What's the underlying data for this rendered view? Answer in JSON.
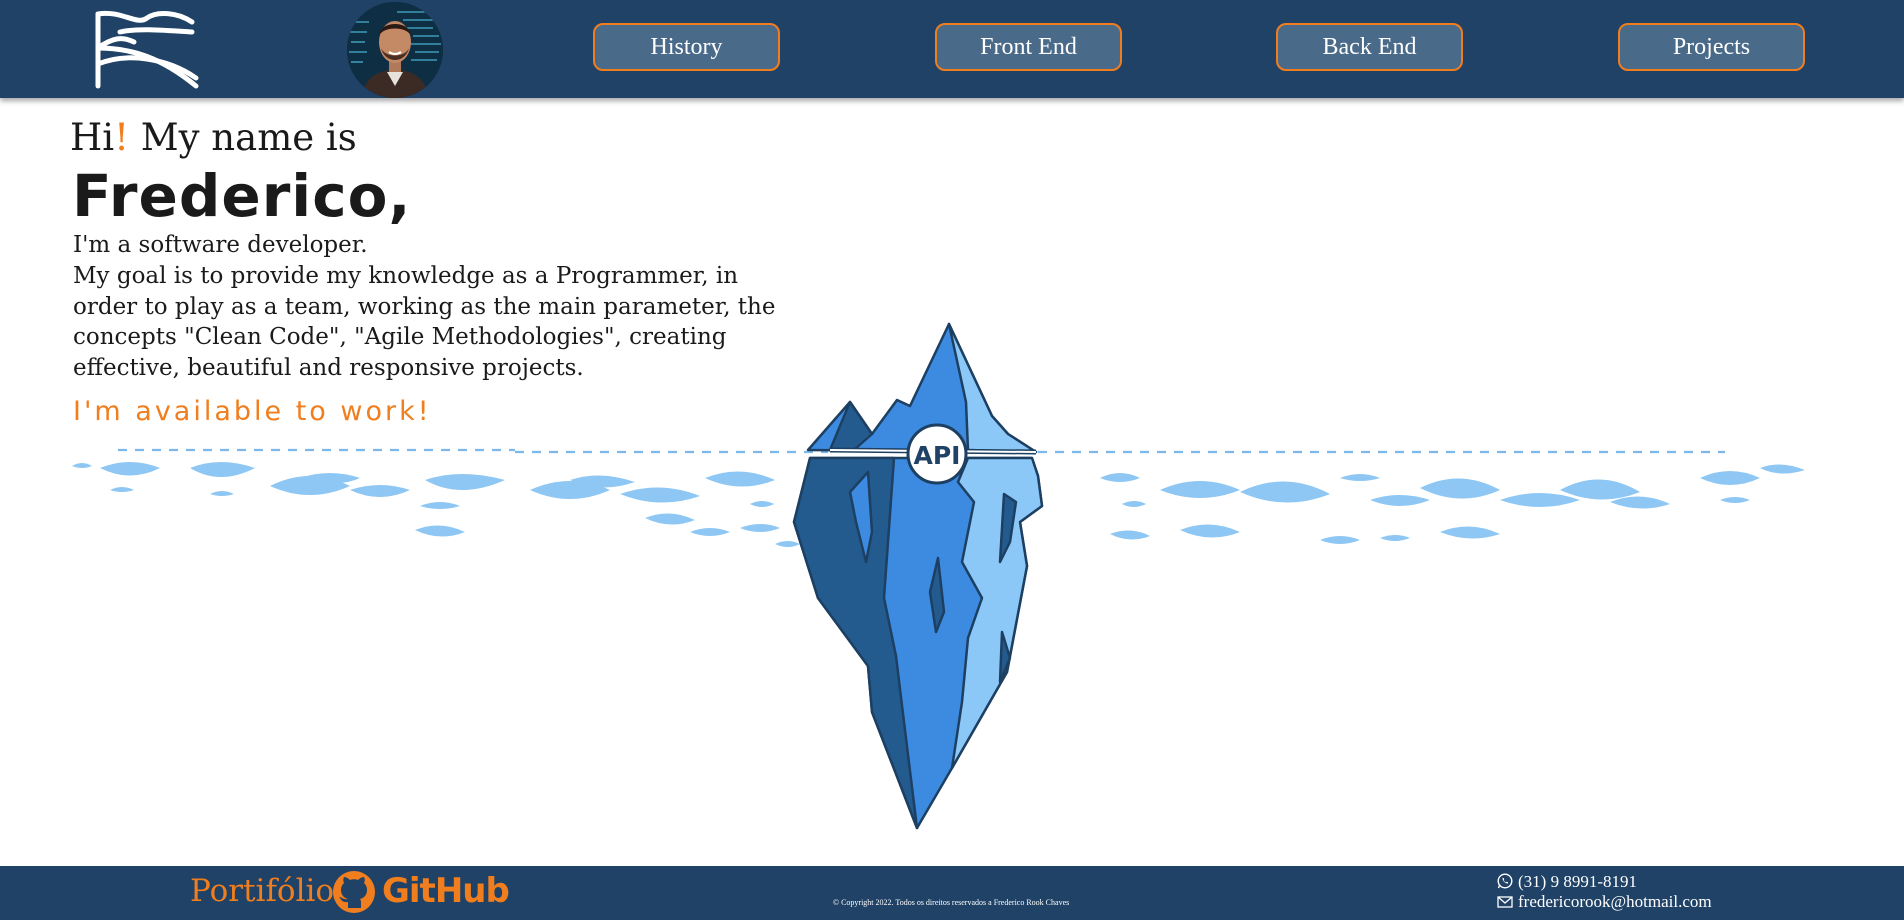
{
  "header": {
    "logo_icon": "fc-monogram-logo",
    "avatar_icon": "profile-photo",
    "nav": [
      {
        "label": "History"
      },
      {
        "label": "Front End"
      },
      {
        "label": "Back End"
      },
      {
        "label": "Projects"
      }
    ]
  },
  "intro": {
    "hi": "Hi",
    "hi_accent": "!",
    "my_name_is": "My name is",
    "name": "Frederico,",
    "role": "I'm a software developer.",
    "goal": "My goal is to provide my knowledge as a Programmer, in order to play as a team, working as the main parameter, the concepts \"Clean Code\", \"Agile Methodologies\", creating effective, beautiful and responsive projects.",
    "available": "I'm available to work!"
  },
  "illustration": {
    "badge": "API"
  },
  "footer": {
    "portfolio": "Portifólio",
    "github": "GitHub",
    "copyright": "© Copyright 2022. Todos os direitos reservados a Frederico Rook Chaves",
    "phone": "(31) 9 8991-8191",
    "email": "fredericorook@hotmail.com"
  },
  "colors": {
    "header_bg": "#1f4266",
    "accent": "#f07e1e",
    "button_bg": "#4a6a8a",
    "iceberg_dark": "#245b8f",
    "iceberg_mid": "#3d8be0",
    "iceberg_light": "#8cc8f7",
    "water": "#8ec7f3"
  }
}
